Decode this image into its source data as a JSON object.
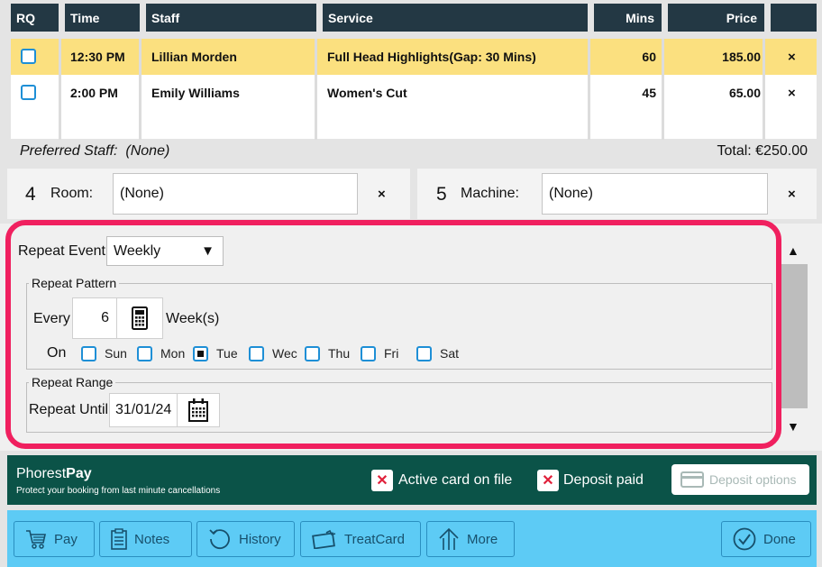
{
  "table": {
    "headers": {
      "rq": "RQ",
      "time": "Time",
      "staff": "Staff",
      "service": "Service",
      "mins": "Mins",
      "price": "Price"
    },
    "rows": [
      {
        "time": "12:30 PM",
        "staff": "Lillian Morden",
        "service": "Full Head Highlights(Gap: 30 Mins)",
        "mins": "60",
        "price": "185.00",
        "remove": "×"
      },
      {
        "time": "2:00 PM",
        "staff": "Emily Williams",
        "service": "Women's Cut",
        "mins": "45",
        "price": "65.00",
        "remove": "×"
      }
    ],
    "preferred_label": "Preferred Staff:",
    "preferred_value": "(None)",
    "total": "Total: €250.00"
  },
  "room": {
    "number": "4",
    "label": "Room:",
    "value": "(None)",
    "remove": "×"
  },
  "machine": {
    "number": "5",
    "label": "Machine:",
    "value": "(None)",
    "remove": "×"
  },
  "repeat": {
    "event_label": "Repeat Event",
    "event_value": "Weekly",
    "pattern_legend": "Repeat Pattern",
    "every_label": "Every",
    "every_value": "6",
    "unit": "Week(s)",
    "on_label": "On",
    "days": [
      {
        "label": "Sun",
        "checked": false
      },
      {
        "label": "Mon",
        "checked": false
      },
      {
        "label": "Tue",
        "checked": true
      },
      {
        "label": "Wec",
        "checked": false
      },
      {
        "label": "Thu",
        "checked": false
      },
      {
        "label": "Fri",
        "checked": false
      },
      {
        "label": "Sat",
        "checked": false
      }
    ],
    "range_legend": "Repeat Range",
    "until_label": "Repeat Until",
    "until_value": "31/01/24"
  },
  "phorest_pay": {
    "title_part1": "Phorest",
    "title_part2": "Pay",
    "subtitle": "Protect your booking from last minute cancellations",
    "active_card": "Active card on file",
    "deposit_paid": "Deposit paid",
    "deposit_options": "Deposit options"
  },
  "toolbar": {
    "pay": "Pay",
    "notes": "Notes",
    "history": "History",
    "treatcard": "TreatCard",
    "more": "More",
    "done": "Done"
  },
  "colors": {
    "header_bg": "#233844",
    "selected_row": "#fbe07f",
    "highlight": "#f0205f",
    "pay_bar": "#0b5348",
    "toolbar": "#5dcbf5",
    "checkbox": "#1e8fd6"
  }
}
